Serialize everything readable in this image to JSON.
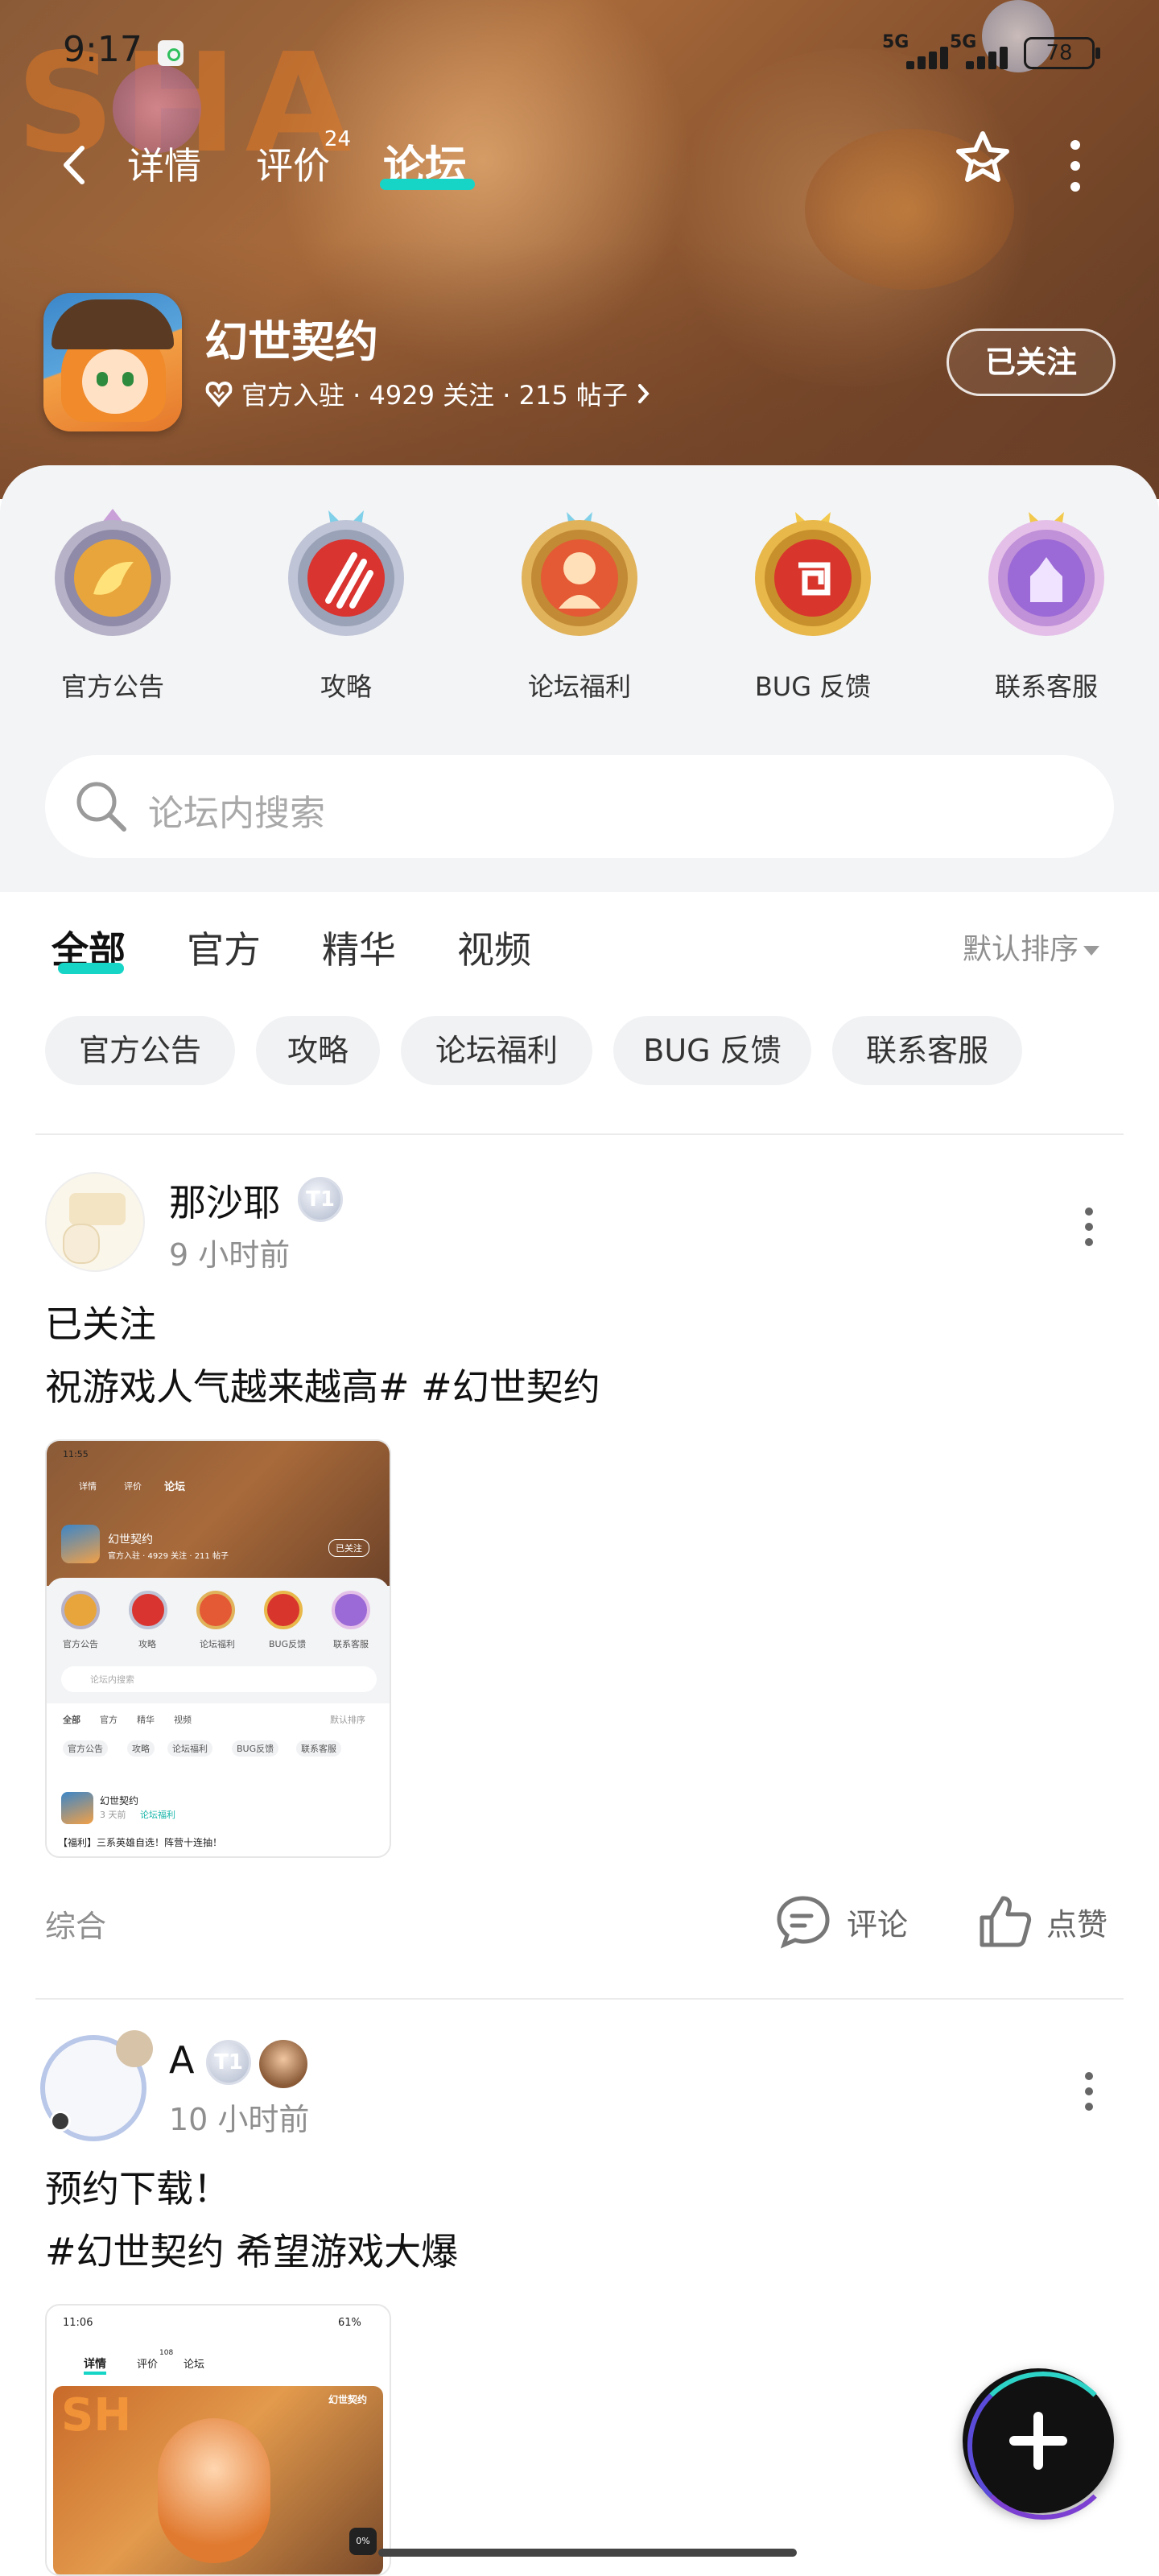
{
  "status_bar": {
    "time": "9:17",
    "network_1": "5G",
    "network_2": "5G",
    "battery": "78"
  },
  "header": {
    "tabs": [
      {
        "label": "详情"
      },
      {
        "label": "评价",
        "count": "24"
      },
      {
        "label": "论坛",
        "active": true
      }
    ],
    "game": {
      "title": "幻世契约",
      "meta": "官方入驻 · 4929 关注 · 215 帖子",
      "follow_label": "已关注"
    }
  },
  "categories": [
    {
      "label": "官方公告",
      "icon": "banana-badge-icon",
      "color": "#e8a53b"
    },
    {
      "label": "攻略",
      "icon": "claw-badge-icon",
      "color": "#d9342f"
    },
    {
      "label": "论坛福利",
      "icon": "character-badge-icon",
      "color": "#e35a35"
    },
    {
      "label": "BUG 反馈",
      "icon": "spiral-badge-icon",
      "color": "#d8362c"
    },
    {
      "label": "联系客服",
      "icon": "castle-badge-icon",
      "color": "#9b6ad6"
    }
  ],
  "search": {
    "placeholder": "论坛内搜索"
  },
  "feed": {
    "tabs": [
      "全部",
      "官方",
      "精华",
      "视频"
    ],
    "sort_label": "默认排序",
    "chips": [
      "官方公告",
      "攻略",
      "论坛福利",
      "BUG 反馈",
      "联系客服"
    ]
  },
  "posts": [
    {
      "username": "那沙耶",
      "level": "T1",
      "time": "9 小时前",
      "line1": "已关注",
      "line2": "祝游戏人气越来越高# #幻世契约",
      "category": "综合",
      "comment_label": "评论",
      "like_label": "点赞",
      "thumb": {
        "time": "11:55",
        "tabs": [
          "详情",
          "评价",
          "论坛"
        ],
        "title": "幻世契约",
        "meta": "官方入驻 · 4929 关注 · 211 帖子",
        "follow": "已关注",
        "cats": [
          "官方公告",
          "攻略",
          "论坛福利",
          "BUG反馈",
          "联系客服"
        ],
        "search": "论坛内搜索",
        "feed_tabs": [
          "全部",
          "官方",
          "精华",
          "视频"
        ],
        "sort": "默认排序",
        "chips": [
          "官方公告",
          "攻略",
          "论坛福利",
          "BUG反馈",
          "联系客服"
        ],
        "post_title": "幻世契约",
        "post_time": "3 天前",
        "post_tag": "论坛福利",
        "post_text": "【福利】三系英雄自选！阵营十连抽！"
      }
    },
    {
      "username": "A",
      "level": "T1",
      "time": "10 小时前",
      "line1": "预约下载！",
      "line2": "#幻世契约 希望游戏大爆",
      "thumb": {
        "time": "11:06",
        "battery": "61%",
        "tabs": [
          "详情",
          "评价",
          "论坛"
        ],
        "count": "108",
        "logo": "幻世契约",
        "progress": "0%"
      }
    }
  ],
  "colors": {
    "accent": "#16d5c6",
    "banner": "#a86a3a",
    "panel": "#f3f4f6"
  }
}
